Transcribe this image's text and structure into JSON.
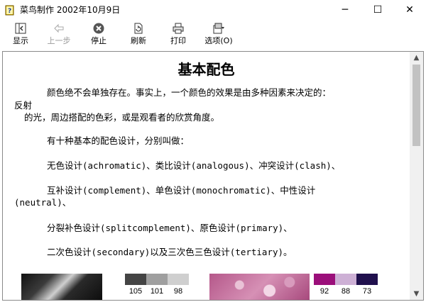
{
  "window": {
    "title": "菜鸟制作  2002年10月9日",
    "icon": "help-book-icon",
    "controls": {
      "minimize": "─",
      "maximize": "☐",
      "close": "✕"
    }
  },
  "toolbar": {
    "show_label": "显示",
    "back_label": "上一步",
    "stop_label": "停止",
    "refresh_label": "刷新",
    "print_label": "打印",
    "options_label": "选项(O)"
  },
  "content": {
    "title": "基本配色",
    "p1_line1": "颜色绝不会单独存在。事实上，一个颜色的效果是由多种因素来决定的：",
    "p1_line2": "反射",
    "p1_line3": "的光，周边搭配的色彩，或是观看者的欣赏角度。",
    "p2": "有十种基本的配色设计，分别叫做：",
    "p3": "无色设计(achromatic)、类比设计(analogous)、冲突设计(clash)、",
    "p4_line1": "互补设计(complement)、单色设计(monochromatic)、中性设计",
    "p4_line2": "(neutral)、",
    "p5": "分裂补色设计(splitcomplement)、原色设计(primary)、",
    "p6": "二次色设计(secondary)以及三次色三色设计(tertiary)。"
  },
  "swatches": {
    "left": [
      {
        "value": "105",
        "color": "#444444"
      },
      {
        "value": "101",
        "color": "#9f9f9f"
      },
      {
        "value": "98",
        "color": "#cfcfcf"
      }
    ],
    "right": [
      {
        "value": "92",
        "color": "#9b0f7a"
      },
      {
        "value": "88",
        "color": "#cdb0d5"
      },
      {
        "value": "73",
        "color": "#20104d"
      }
    ]
  },
  "scrollbar": {
    "up": "▲",
    "down": "▼"
  }
}
